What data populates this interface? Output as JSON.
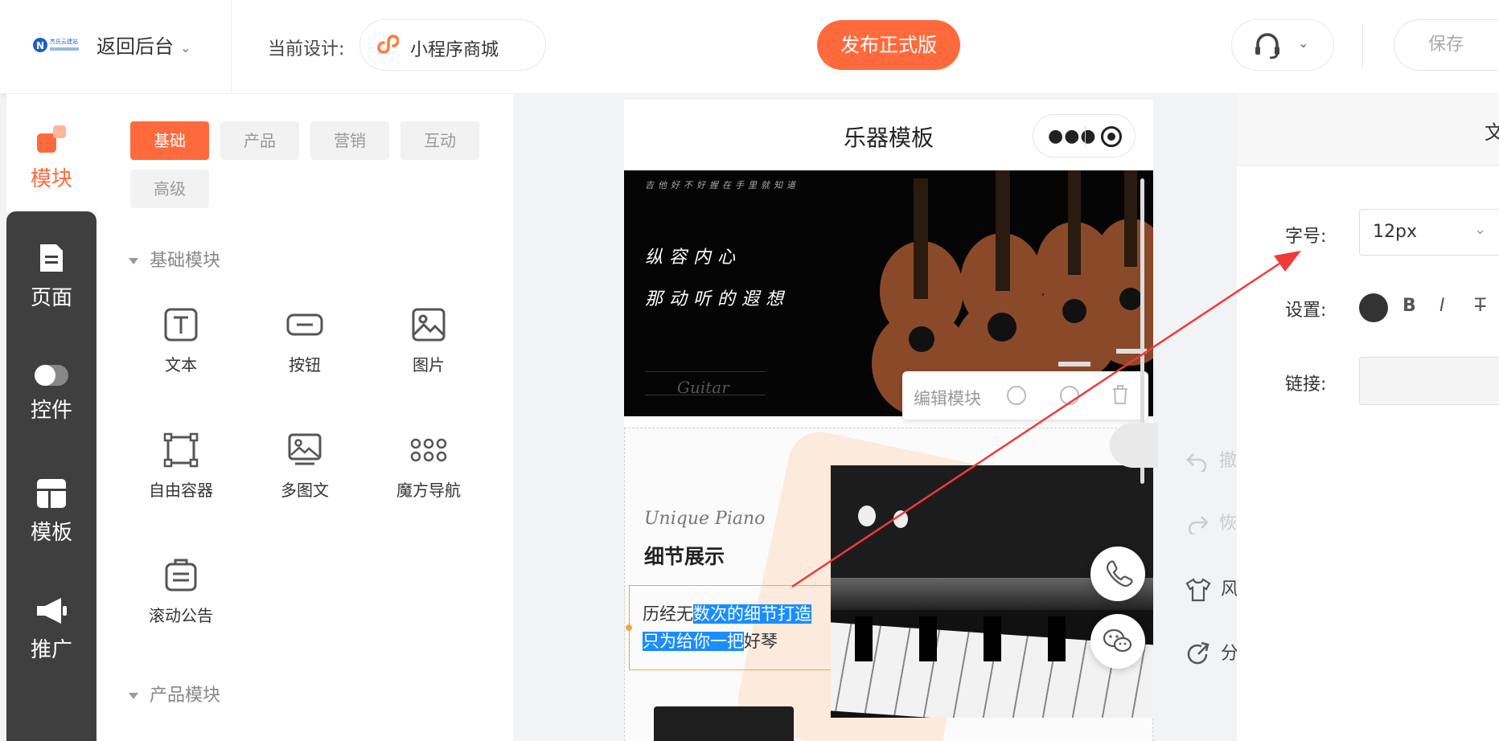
{
  "header": {
    "logo_text": "杰氏云建站",
    "back_label": "返回后台",
    "current_design_label": "当前设计:",
    "design_name": "小程序商城",
    "publish_label": "发布正式版",
    "save_label": "保存"
  },
  "rail": {
    "items": [
      {
        "label": "模块",
        "icon": "modules-icon"
      },
      {
        "label": "页面",
        "icon": "page-icon"
      },
      {
        "label": "控件",
        "icon": "toggle-icon"
      },
      {
        "label": "模板",
        "icon": "template-icon"
      },
      {
        "label": "推广",
        "icon": "megaphone-icon"
      }
    ]
  },
  "panel": {
    "tabs": [
      "基础",
      "产品",
      "营销",
      "互动",
      "高级"
    ],
    "section_basic": "基础模块",
    "section_product": "产品模块",
    "components": [
      "文本",
      "按钮",
      "图片",
      "自由容器",
      "多图文",
      "魔方导航",
      "滚动公告"
    ]
  },
  "phone": {
    "title": "乐器模板",
    "banner_small": "吉他好不好握在手里就知道",
    "banner_line1": "纵容内心",
    "banner_line2": "那动听的遐想",
    "banner_script": "Guitar",
    "edit_label": "编辑模块",
    "unique": "Unique Piano",
    "detail_title": "细节展示",
    "detail_p1": "历经无",
    "detail_p2": "数次的细节打造",
    "detail_p3": "只为给你一把",
    "detail_p4": "好琴"
  },
  "tools": [
    "撤",
    "恢",
    "风",
    "分"
  ],
  "props": {
    "head": "文",
    "font_label": "字号:",
    "font_value": "12px",
    "settings_label": "设置:",
    "link_label": "链接:",
    "bold": "B",
    "italic": "I",
    "strike": "T"
  },
  "colors": {
    "accent": "#ff6a3d",
    "rail": "#3f3f3f",
    "highlight": "#1a8dff",
    "arrow": "#f03a3a"
  }
}
